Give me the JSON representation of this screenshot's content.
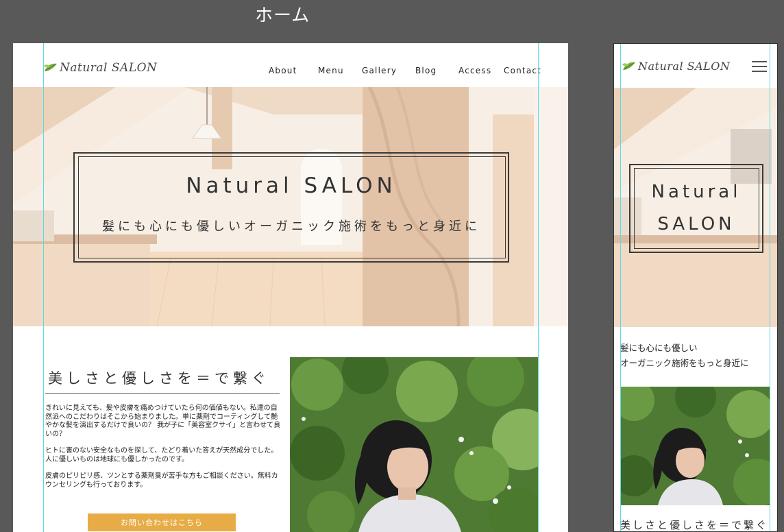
{
  "artboard_title": "ホーム",
  "brand": {
    "name": "Natural SALON"
  },
  "nav": {
    "items": [
      {
        "label": "About"
      },
      {
        "label": "Menu"
      },
      {
        "label": "Gallery"
      },
      {
        "label": "Blog"
      },
      {
        "label": "Access"
      },
      {
        "label": "Contact"
      }
    ]
  },
  "hero": {
    "title": "Natural SALON",
    "subtitle": "髪にも心にも優しいオーガニック施術をもっと身近に"
  },
  "intro": {
    "title": "美しさと優しさを＝で繋ぐ",
    "paragraphs": [
      "きれいに見えても、髪や皮膚を痛めつけていたら何の価値もない。私達の自然派へのこだわりはそこから始まりました。単に薬剤でコーティングして艶やかな髪を演出するだけで良いの？ 我が子に「美容室クサイ」と言わせて良いの？",
      "ヒトに害のない安全なものを探して、たどり着いた答えが天然成分でした。人に優しいものは地球にも優しかったのです。",
      "皮膚のピリピリ感、ツンとする薬剤臭が苦手な方もご相談ください。無料カウンセリングも行っております。"
    ],
    "cta_label": "お問い合わせはこちら"
  },
  "mobile": {
    "hero_title_line1": "Natural",
    "hero_title_line2": "SALON",
    "subtitle_line1": "髪にも心にも優しい",
    "subtitle_line2": "オーガニック施術をもっと身近に",
    "intro_title": "美しさと優しさを＝で繋ぐ"
  },
  "icons": {
    "logo": "leaf-icon",
    "menu": "hamburger-menu-icon"
  },
  "colors": {
    "canvas": "#595959",
    "accent": "#e8ac46",
    "guide": "#5fd8e4"
  }
}
